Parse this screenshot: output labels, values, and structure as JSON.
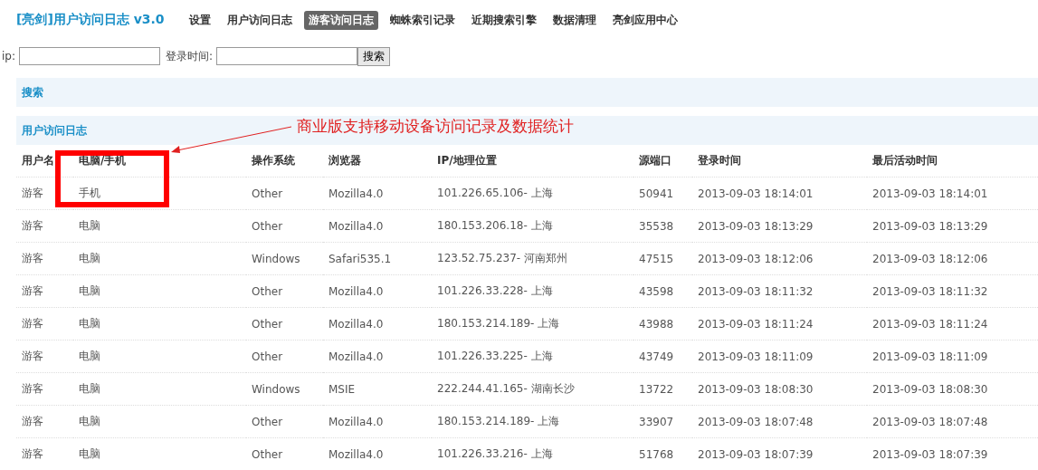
{
  "title": "[亮剑]用户访问日志 v3.0",
  "nav": [
    {
      "label": "设置",
      "selected": false
    },
    {
      "label": "用户访问日志",
      "selected": false
    },
    {
      "label": "游客访问日志",
      "selected": true
    },
    {
      "label": "蜘蛛索引记录",
      "selected": false
    },
    {
      "label": "近期搜索引擎",
      "selected": false
    },
    {
      "label": "数据清理",
      "selected": false
    },
    {
      "label": "亮剑应用中心",
      "selected": false
    }
  ],
  "filters": [
    {
      "label": "ip:"
    },
    {
      "label": "登录时间:"
    }
  ],
  "search_button": "搜索",
  "search_bar": "搜索",
  "section_title": "用户访问日志",
  "annotation": "商业版支持移动设备访问记录及数据统计",
  "table": {
    "columns": [
      "用户名",
      "电脑/手机",
      "操作系统",
      "浏览器",
      "IP/地理位置",
      "源端口",
      "登录时间",
      "最后活动时间"
    ],
    "rows": [
      [
        "游客",
        "手机",
        "Other",
        "Mozilla4.0",
        "101.226.65.106- 上海",
        "50941",
        "2013-09-03 18:14:01",
        "2013-09-03 18:14:01"
      ],
      [
        "游客",
        "电脑",
        "Other",
        "Mozilla4.0",
        "180.153.206.18- 上海",
        "35538",
        "2013-09-03 18:13:29",
        "2013-09-03 18:13:29"
      ],
      [
        "游客",
        "电脑",
        "Windows",
        "Safari535.1",
        "123.52.75.237- 河南郑州",
        "47515",
        "2013-09-03 18:12:06",
        "2013-09-03 18:12:06"
      ],
      [
        "游客",
        "电脑",
        "Other",
        "Mozilla4.0",
        "101.226.33.228- 上海",
        "43598",
        "2013-09-03 18:11:32",
        "2013-09-03 18:11:32"
      ],
      [
        "游客",
        "电脑",
        "Other",
        "Mozilla4.0",
        "180.153.214.189- 上海",
        "43988",
        "2013-09-03 18:11:24",
        "2013-09-03 18:11:24"
      ],
      [
        "游客",
        "电脑",
        "Other",
        "Mozilla4.0",
        "101.226.33.225- 上海",
        "43749",
        "2013-09-03 18:11:09",
        "2013-09-03 18:11:09"
      ],
      [
        "游客",
        "电脑",
        "Windows",
        "MSIE",
        "222.244.41.165- 湖南长沙",
        "13722",
        "2013-09-03 18:08:30",
        "2013-09-03 18:08:30"
      ],
      [
        "游客",
        "电脑",
        "Other",
        "Mozilla4.0",
        "180.153.214.189- 上海",
        "33907",
        "2013-09-03 18:07:48",
        "2013-09-03 18:07:48"
      ],
      [
        "游客",
        "电脑",
        "Other",
        "Mozilla4.0",
        "101.226.33.216- 上海",
        "51768",
        "2013-09-03 18:07:39",
        "2013-09-03 18:07:39"
      ]
    ]
  }
}
